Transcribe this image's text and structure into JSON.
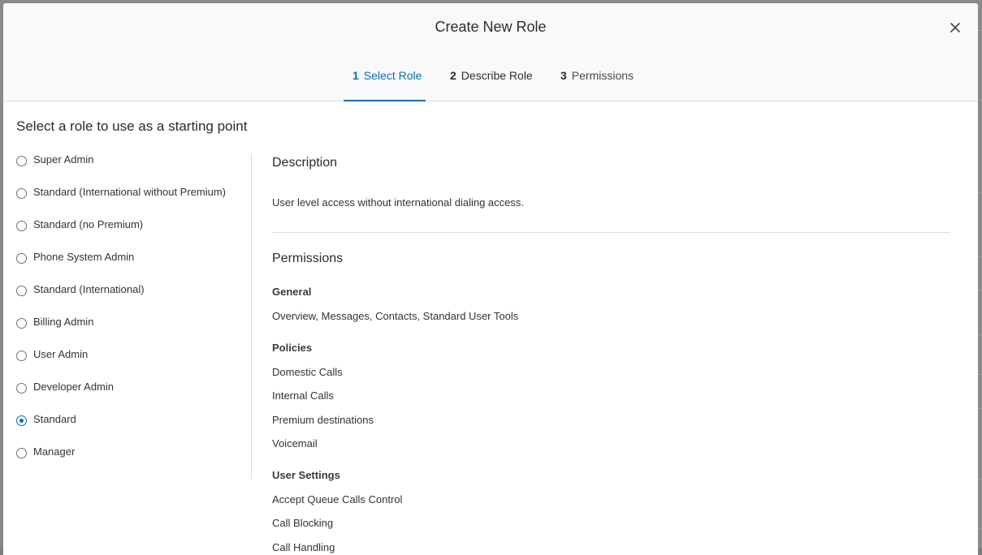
{
  "modal": {
    "title": "Create New Role",
    "close_label": "×"
  },
  "steps": [
    {
      "number": "1",
      "label": "Select Role",
      "state": "active"
    },
    {
      "number": "2",
      "label": "Describe Role",
      "state": "incomplete"
    },
    {
      "number": "3",
      "label": "Permissions",
      "state": "incomplete"
    }
  ],
  "colors": {
    "accent": "#066fac",
    "header_bg": "#f9f9f9",
    "divider": "#dcdcdc"
  },
  "role_select": {
    "heading": "Select a role to use as a starting point",
    "selected": "Standard",
    "roles": [
      "Super Admin",
      "Standard (International without Premium)",
      "Standard (no Premium)",
      "Phone System Admin",
      "Standard (International)",
      "Billing Admin",
      "User Admin",
      "Developer Admin",
      "Standard",
      "Manager"
    ]
  },
  "detail": {
    "description_heading": "Description",
    "description_text": "User level access without international dialing access.",
    "permissions_heading": "Permissions",
    "groups": [
      {
        "title": "General",
        "items": [
          "Overview, Messages, Contacts, Standard User Tools"
        ]
      },
      {
        "title": "Policies",
        "items": [
          "Domestic Calls",
          "Internal Calls",
          "Premium destinations",
          "Voicemail"
        ]
      },
      {
        "title": "User Settings",
        "items": [
          "Accept Queue Calls Control",
          "Call Blocking",
          "Call Handling"
        ]
      }
    ]
  }
}
